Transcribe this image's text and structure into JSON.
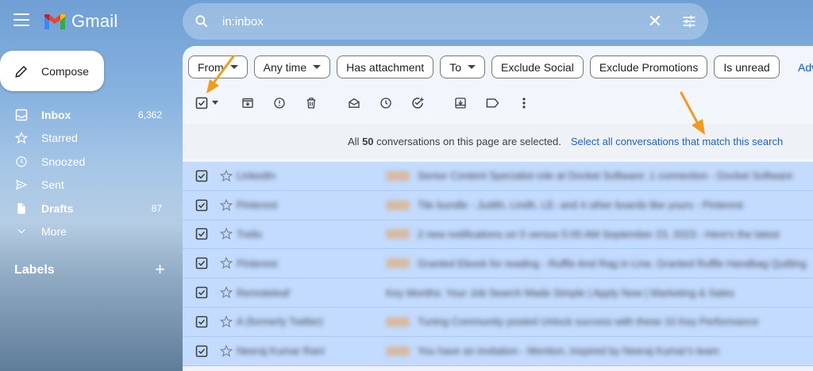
{
  "app": {
    "name": "Gmail"
  },
  "search": {
    "query": "in:inbox"
  },
  "sidebar": {
    "compose_label": "Compose",
    "items": [
      {
        "label": "Inbox",
        "count": "6,362",
        "bold": true,
        "icon": "inbox-icon"
      },
      {
        "label": "Starred",
        "count": "",
        "bold": false,
        "icon": "star-icon"
      },
      {
        "label": "Snoozed",
        "count": "",
        "bold": false,
        "icon": "clock-icon"
      },
      {
        "label": "Sent",
        "count": "",
        "bold": false,
        "icon": "send-icon"
      },
      {
        "label": "Drafts",
        "count": "87",
        "bold": true,
        "icon": "draft-icon"
      },
      {
        "label": "More",
        "count": "",
        "bold": false,
        "icon": "chevron-down-icon"
      }
    ],
    "labels_heading": "Labels",
    "labels_add": "+"
  },
  "filters": {
    "chips": [
      {
        "label": "From",
        "dropdown": true
      },
      {
        "label": "Any time",
        "dropdown": true
      },
      {
        "label": "Has attachment",
        "dropdown": false
      },
      {
        "label": "To",
        "dropdown": true
      },
      {
        "label": "Exclude Social",
        "dropdown": false
      },
      {
        "label": "Exclude Promotions",
        "dropdown": false
      },
      {
        "label": "Is unread",
        "dropdown": false
      }
    ],
    "advanced_partial": "Adv"
  },
  "toolbar": {
    "icons": [
      "select-all-checkbox-icon",
      "archive-icon",
      "report-spam-icon",
      "delete-icon",
      "mark-read-icon",
      "snooze-icon",
      "add-to-tasks-icon",
      "move-to-icon",
      "label-icon",
      "more-vert-icon"
    ]
  },
  "selection": {
    "pre": "All ",
    "count": "50",
    "post": " conversations on this page are selected.",
    "select_all_link": "Select all conversations that match this search"
  },
  "emails": [
    {
      "sender": "LinkedIn",
      "subject": "Senior Content Specialist role at Docket Software: 1 connection",
      "snippet": " - Docket Software"
    },
    {
      "sender": "Pinterest",
      "subject": "Tile bundle - Judith, Lindh, LE- and 4 other boards like yours",
      "snippet": " - Pinterest"
    },
    {
      "sender": "Trello",
      "subject": "2 new notifications on 5 versus 5:00 AM September 23, 2023",
      "snippet": " - Here's the latest"
    },
    {
      "sender": "Pinterest",
      "subject": "Granted Ebook for reading",
      "snippet": " - Ruffle And Rag in Line, Granted Ruffle Handbag Quilting"
    },
    {
      "sender": "Remoteleaf",
      "subject": "Key Months: Your Job Search Made Simple | Apply Now | Marketing & Sales",
      "snippet": ""
    },
    {
      "sender": "A (formerly Twitter)",
      "subject": "Tuning Community posted Unlock success with these 10 Key Performance",
      "snippet": ""
    },
    {
      "sender": "Neeraj Kumar Rani",
      "subject": "You have an invitation",
      "snippet": " - Mention, inspired by Neeraj Kumar's team"
    }
  ],
  "colors": {
    "accent": "#0b57d0",
    "selected_row": "#c2dbff",
    "annotation_arrow": "#f29a1e"
  }
}
